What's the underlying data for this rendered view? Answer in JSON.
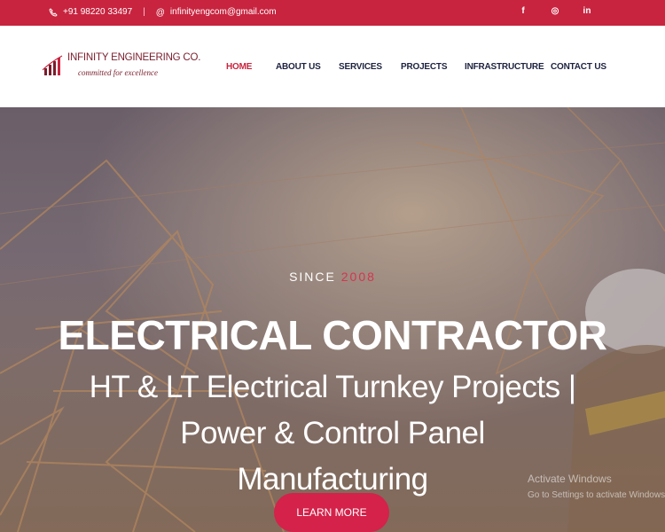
{
  "topbar": {
    "phone": "+91 98220 33497",
    "email": "infinityengcom@gmail.com",
    "social": [
      {
        "icon": "facebook-icon",
        "glyph": "f"
      },
      {
        "icon": "instagram-icon",
        "glyph": "◎"
      },
      {
        "icon": "linkedin-icon",
        "glyph": "in"
      }
    ]
  },
  "logo": {
    "name": "INFINITY ENGINEERING CO.",
    "tagline": "committed for excellence"
  },
  "nav": {
    "items": [
      "HOME",
      "ABOUT US",
      "SERVICES",
      "PROJECTS",
      "INFRASTRUCTURE",
      "CONTACT US"
    ],
    "active": "HOME"
  },
  "hero": {
    "since_label": "SINCE",
    "since_year": "2008",
    "title": "ELECTRICAL CONTRACTOR",
    "subtitle": "HT & LT Electrical Turnkey Projects | Power & Control Panel Manufacturing",
    "cta": "LEARN MORE"
  },
  "watermark": {
    "line1": "Activate Windows",
    "line2": "Go to Settings to activate Windows."
  },
  "colors": {
    "brand": "#c8243f",
    "nav_text": "#1d2240",
    "cta": "#d4224a"
  }
}
